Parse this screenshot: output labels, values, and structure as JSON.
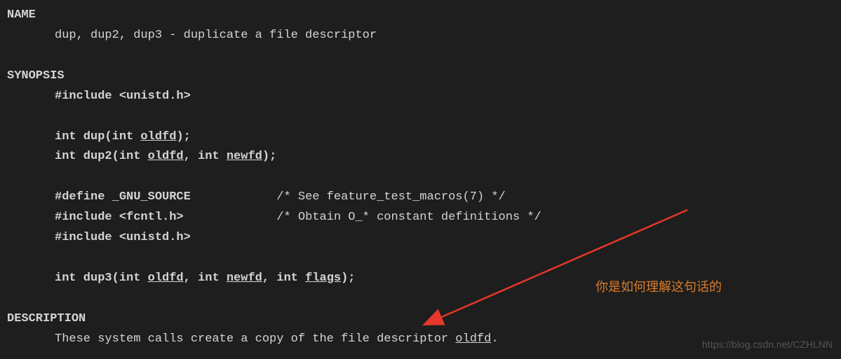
{
  "name": {
    "header": "NAME",
    "line": "dup, dup2, dup3 - duplicate a file descriptor"
  },
  "synopsis": {
    "header": "SYNOPSIS",
    "inc1": "#include <unistd.h>",
    "dup": {
      "kw1": "int dup(int ",
      "arg1": "oldfd",
      "end": ");"
    },
    "dup2": {
      "kw1": "int dup2(int ",
      "arg1": "oldfd",
      "kw2": ", int ",
      "arg2": "newfd",
      "end": ");"
    },
    "def": {
      "directive": "#define _GNU_SOURCE",
      "pad": "            ",
      "comment": "/* See feature_test_macros(7) */"
    },
    "inc2": {
      "directive": "#include <fcntl.h>",
      "pad": "             ",
      "comment": "/* Obtain O_* constant definitions */"
    },
    "inc3": "#include <unistd.h>",
    "dup3": {
      "kw1": "int dup3(int ",
      "arg1": "oldfd",
      "kw2": ", int ",
      "arg2": "newfd",
      "kw3": ", int ",
      "arg3": "flags",
      "end": ");"
    }
  },
  "description": {
    "header": "DESCRIPTION",
    "line_pre": "These system calls create a copy of the file descriptor ",
    "oldfd": "oldfd",
    "line_post": "."
  },
  "annotation": "你是如何理解这句话的",
  "watermark": "https://blog.csdn.net/CZHLNN"
}
